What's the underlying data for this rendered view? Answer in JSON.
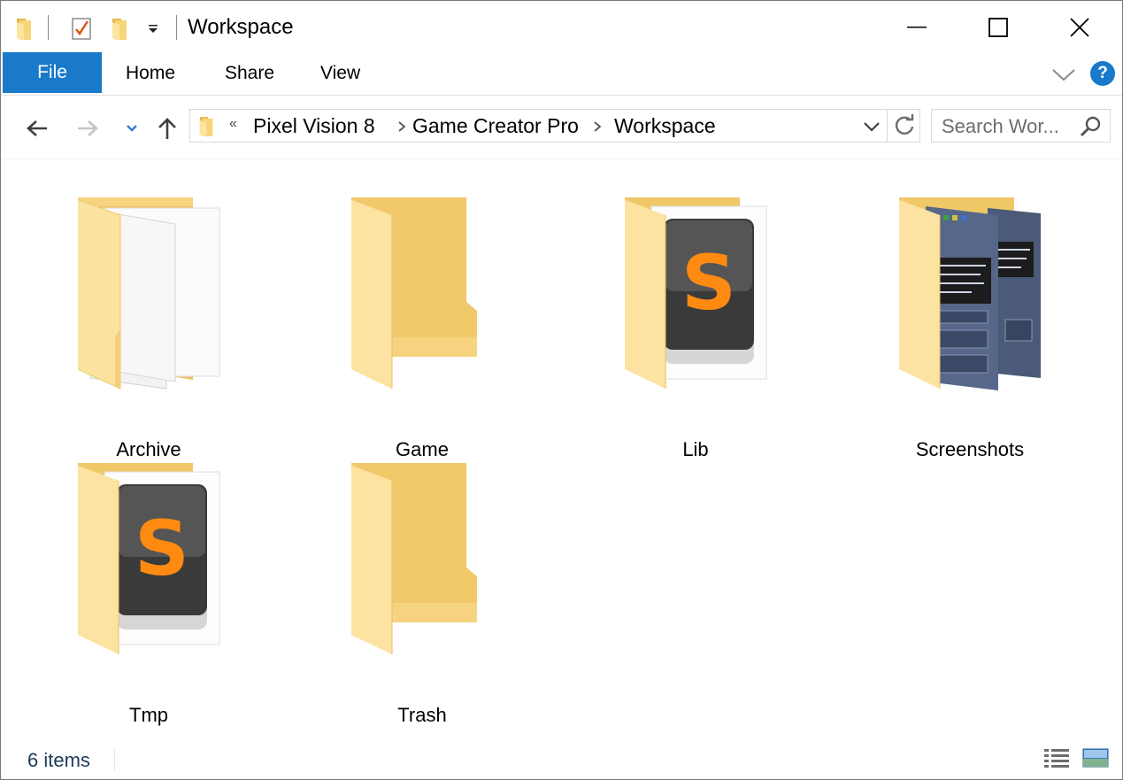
{
  "window": {
    "title": "Workspace"
  },
  "quick_access": {
    "folder_icon": "folder-icon",
    "properties_icon": "properties-check-icon",
    "new_folder_icon": "new-folder-icon",
    "customize_icon": "dropdown-arrow-icon"
  },
  "window_controls": {
    "minimize_icon": "minimize-icon",
    "maximize_icon": "maximize-icon",
    "close_icon": "close-icon"
  },
  "ribbon": {
    "file_tab": "File",
    "tabs": [
      {
        "label": "Home"
      },
      {
        "label": "Share"
      },
      {
        "label": "View"
      }
    ],
    "help_label": "?",
    "accent": "#1979ca"
  },
  "nav": {
    "overflow": "«",
    "breadcrumbs": [
      {
        "label": "Pixel Vision 8"
      },
      {
        "label": "Game Creator Pro"
      },
      {
        "label": "Workspace"
      }
    ],
    "search_placeholder": "Search Wor..."
  },
  "items": [
    {
      "label": "Archive",
      "icon": "folder-with-documents-icon"
    },
    {
      "label": "Game",
      "icon": "folder-icon"
    },
    {
      "label": "Lib",
      "icon": "folder-sublime-icon"
    },
    {
      "label": "Screenshots",
      "icon": "folder-screenshots-icon"
    },
    {
      "label": "Tmp",
      "icon": "folder-sublime-icon"
    },
    {
      "label": "Trash",
      "icon": "folder-icon"
    }
  ],
  "status": {
    "item_count": "6 items"
  }
}
